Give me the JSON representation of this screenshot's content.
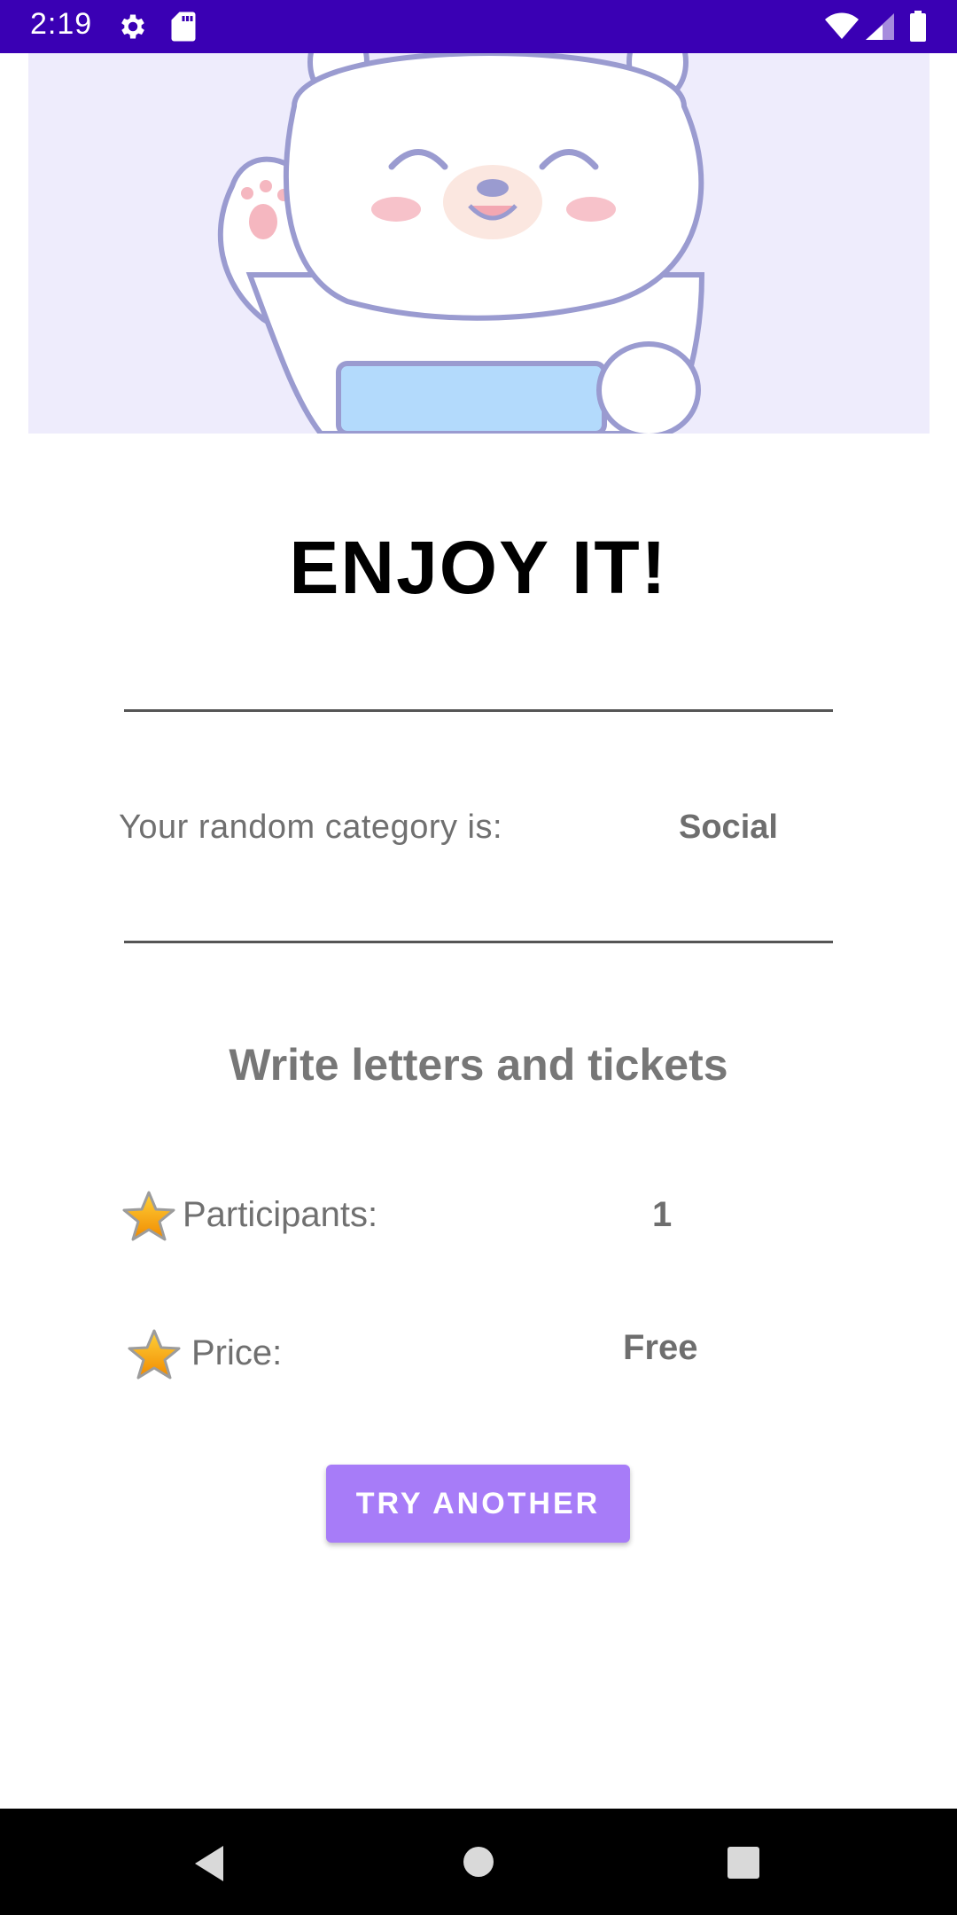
{
  "status_bar": {
    "time": "2:19",
    "background": "#3a00b4",
    "icons": [
      "gear-icon",
      "sd-card-icon",
      "wifi-icon",
      "signal-icon",
      "battery-icon"
    ]
  },
  "hero": {
    "icon": "waving-bear-illustration",
    "background": "#eeecfc"
  },
  "title": "ENJOY IT!",
  "category": {
    "label": "Your random category is:",
    "value": "Social"
  },
  "activity": "Write letters and tickets",
  "details": {
    "participants_label": "Participants:",
    "participants_value": "1",
    "price_label": "Price:",
    "price_value": "Free",
    "icon": "star-icon"
  },
  "button": {
    "label": "TRY ANOTHER",
    "color": "#a77cf8"
  },
  "nav_bar": {
    "icons": [
      "back-icon",
      "home-icon",
      "recents-icon"
    ]
  }
}
